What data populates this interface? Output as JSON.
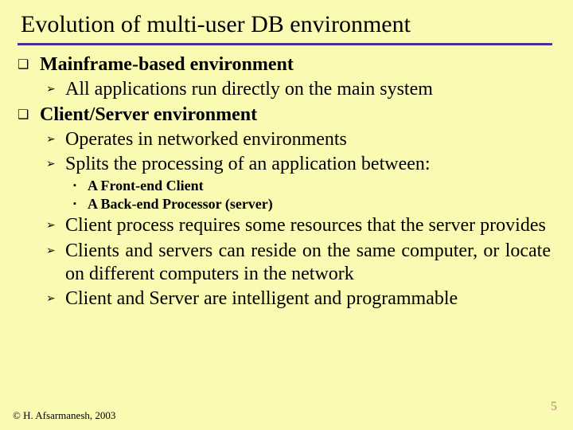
{
  "title": "Evolution of multi-user DB environment",
  "b1": {
    "mainframe": "Mainframe-based environment",
    "mainframe_sub1": "All applications run directly on the main system",
    "cs": "Client/Server environment",
    "cs_sub1": "Operates in networked environments",
    "cs_sub2": "Splits the processing of an application between:",
    "cs_sub2_a": "A Front-end Client",
    "cs_sub2_b": "A Back-end Processor (server)",
    "cs_sub3": "Client process requires some resources that the server provides",
    "cs_sub4": "Clients and servers can reside on the same computer, or locate on different computers in the network",
    "cs_sub5": "Client and Server are intelligent and programmable"
  },
  "glyph": {
    "q": "❑",
    "arrow": "➢",
    "square": "▪"
  },
  "footer": {
    "copyright": "© H. Afsarmanesh, 2003",
    "page": "5"
  }
}
